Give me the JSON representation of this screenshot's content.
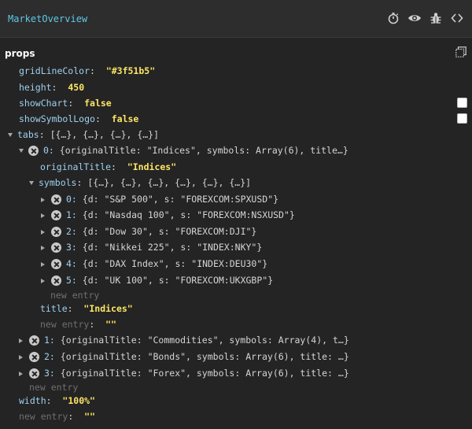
{
  "window": {
    "title": "MarketOverview"
  },
  "toolbar_icons": [
    "stopwatch-icon",
    "eye-icon",
    "bug-icon",
    "code-icon"
  ],
  "props": {
    "label": "props",
    "gridLineColor": {
      "key": "gridLineColor",
      "value": "\"#3f51b5\""
    },
    "height": {
      "key": "height",
      "value": "450"
    },
    "showChart": {
      "key": "showChart",
      "value": "false"
    },
    "showSymbolLogo": {
      "key": "showSymbolLogo",
      "value": "false"
    },
    "tabs": {
      "key": "tabs",
      "summary": "[{…}, {…}, {…}, {…}]",
      "items": [
        {
          "index": "0:",
          "summary": "{originalTitle: \"Indices\", symbols: Array(6), title…}",
          "originalTitle": {
            "key": "originalTitle",
            "value": "\"Indices\""
          },
          "symbols": {
            "key": "symbols",
            "summary": "[{…}, {…}, {…}, {…}, {…}, {…}]",
            "items": [
              {
                "index": "0:",
                "summary": "{d: \"S&P 500\", s: \"FOREXCOM:SPXUSD\"}"
              },
              {
                "index": "1:",
                "summary": "{d: \"Nasdaq 100\", s: \"FOREXCOM:NSXUSD\"}"
              },
              {
                "index": "2:",
                "summary": "{d: \"Dow 30\", s: \"FOREXCOM:DJI\"}"
              },
              {
                "index": "3:",
                "summary": "{d: \"Nikkei 225\", s: \"INDEX:NKY\"}"
              },
              {
                "index": "4:",
                "summary": "{d: \"DAX Index\", s: \"INDEX:DEU30\"}"
              },
              {
                "index": "5:",
                "summary": "{d: \"UK 100\", s: \"FOREXCOM:UKXGBP\"}"
              }
            ],
            "new_entry": "new entry"
          },
          "title": {
            "key": "title",
            "value": "\"Indices\""
          },
          "new_entry": {
            "key": "new entry",
            "value": "\"\""
          }
        },
        {
          "index": "1:",
          "summary": "{originalTitle: \"Commodities\", symbols: Array(4), t…}"
        },
        {
          "index": "2:",
          "summary": "{originalTitle: \"Bonds\", symbols: Array(6), title: …}"
        },
        {
          "index": "3:",
          "summary": "{originalTitle: \"Forex\", symbols: Array(6), title: …}"
        }
      ],
      "new_entry": "new entry"
    },
    "width": {
      "key": "width",
      "value": "\"100%\""
    },
    "new_entry": {
      "key": "new entry",
      "value": "\"\""
    }
  }
}
